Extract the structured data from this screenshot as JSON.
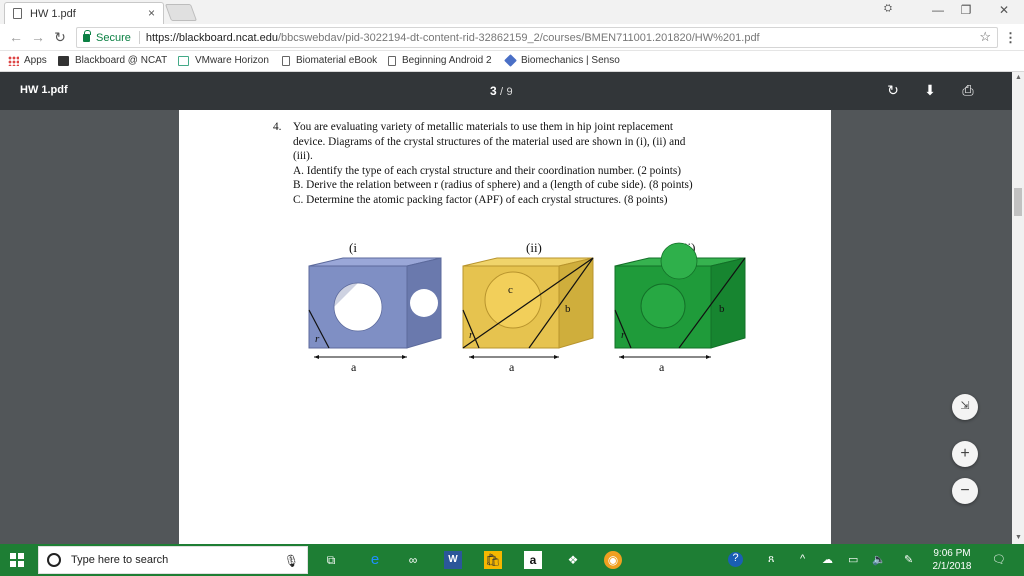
{
  "tab": {
    "title": "HW 1.pdf",
    "close": "×"
  },
  "window_controls": {
    "minimize": "—",
    "restore": "❐",
    "close": "✕",
    "profile": "⛭"
  },
  "omnibox": {
    "secure_label": "Secure",
    "url_host": "https://blackboard.ncat.edu",
    "url_path": "/bbcswebdav/pid-3022194-dt-content-rid-32862159_2/courses/BMEN711001.201820/HW%201.pdf"
  },
  "bookmarks": [
    {
      "label": "Apps"
    },
    {
      "label": "Blackboard @ NCAT"
    },
    {
      "label": "VMware Horizon"
    },
    {
      "label": "Biomaterial eBook"
    },
    {
      "label": "Beginning Android 2"
    },
    {
      "label": "Biomechanics | Senso"
    }
  ],
  "pdf": {
    "title": "HW 1.pdf",
    "current_page": "3",
    "page_sep": "/",
    "total_pages": "9"
  },
  "question": {
    "number": "4.",
    "lines": [
      "You are evaluating variety of metallic materials to use them in hip joint replacement",
      "device. Diagrams of the crystal structures of the material used are shown in (i), (ii) and",
      "(iii).",
      "A. Identify the type of each crystal structure and their coordination number. (2 points)",
      "B. Derive the relation between r (radius of sphere) and a (length of cube side). (8 points)",
      "C. Determine the atomic packing factor (APF) of each crystal structures. (8 points)"
    ]
  },
  "figures": [
    {
      "label": "(i",
      "color": "#7f8fc4",
      "dark": "#5c6a9c",
      "side": "a",
      "radius": "r"
    },
    {
      "label": "(ii)",
      "color": "#e6c34f",
      "dark": "#b8942d",
      "side": "a",
      "radius": "r",
      "diag": "b",
      "body": "c"
    },
    {
      "label": "(iii)",
      "color": "#1f9b3a",
      "dark": "#137028",
      "side": "a",
      "radius": "r",
      "diag": "b"
    }
  ],
  "zoom": {
    "fit": "⇲",
    "in": "+",
    "out": "−"
  },
  "taskbar": {
    "search_placeholder": "Type here to search",
    "time": "9:06 PM",
    "date": "2/1/2018"
  },
  "colors": {
    "taskbar": "#1e7e34",
    "pdf_toolbar": "#323639",
    "viewer_bg": "#525659"
  }
}
